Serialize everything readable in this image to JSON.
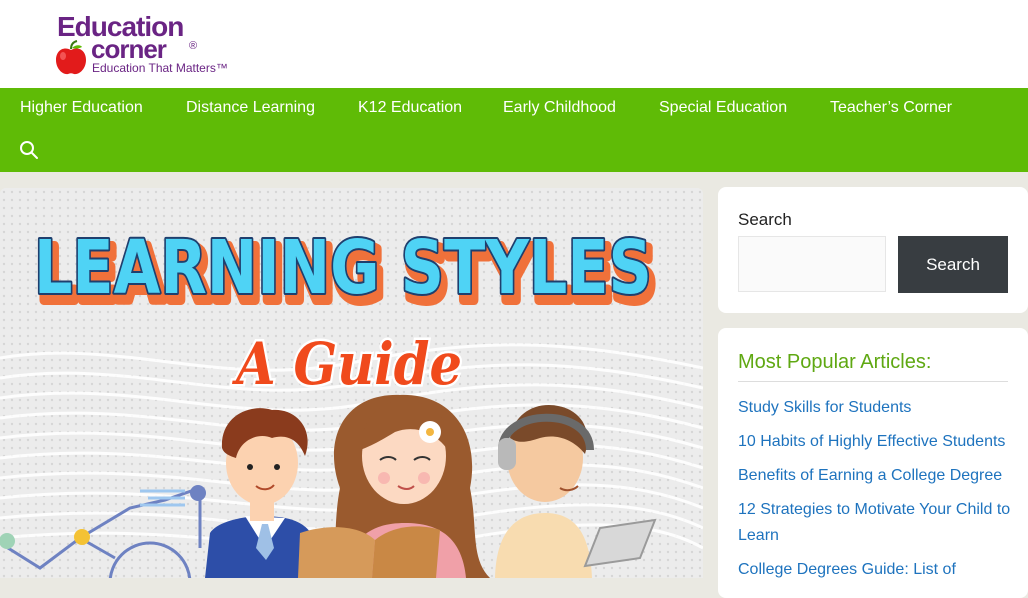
{
  "header": {
    "logo_line1": "Education",
    "logo_line2": "corner",
    "logo_reg": "®",
    "logo_tagline": "Education That Matters™"
  },
  "nav": {
    "items": [
      {
        "label": "Higher Education"
      },
      {
        "label": "Distance Learning"
      },
      {
        "label": "K12 Education"
      },
      {
        "label": "Early Childhood"
      },
      {
        "label": "Special Education"
      },
      {
        "label": "Teacher’s Corner"
      }
    ]
  },
  "hero": {
    "title": "LEARNING STYLES",
    "subtitle": "A Guide"
  },
  "sidebar": {
    "search": {
      "label": "Search",
      "input_value": "",
      "placeholder": "",
      "button": "Search"
    },
    "popular": {
      "title": "Most Popular Articles:",
      "links": [
        "Study Skills for Students",
        "10 Habits of Highly Effective Students",
        "Benefits of Earning a College Degree",
        "12 Strategies to Motivate Your Child to Learn",
        "College Degrees Guide: List of"
      ]
    }
  },
  "colors": {
    "nav_bg": "#5fbb06",
    "brand_purple": "#6a2484",
    "link_blue": "#1e73be",
    "heading_green": "#5fa812",
    "button_dark": "#383d41"
  }
}
